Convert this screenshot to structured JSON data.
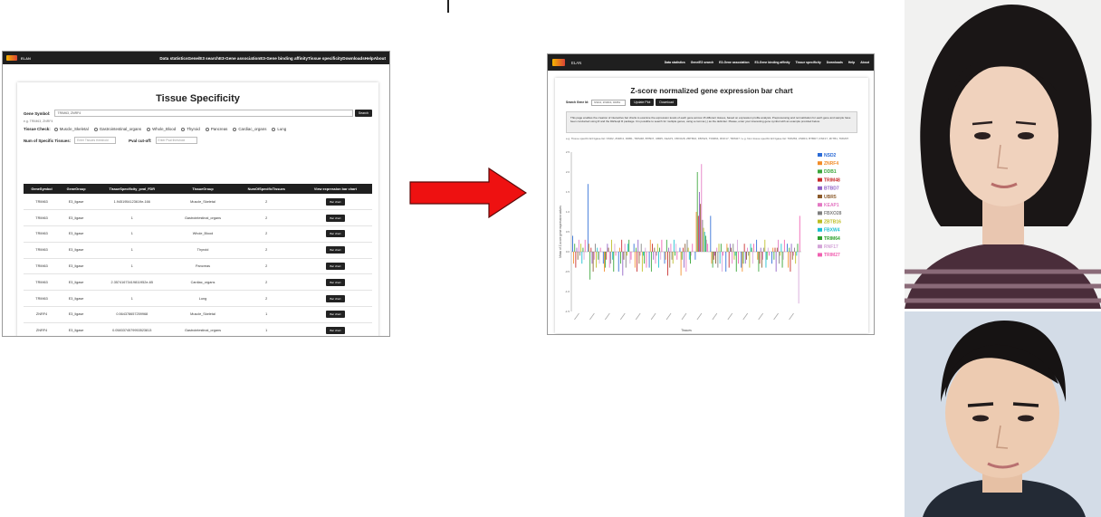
{
  "left_screenshot": {
    "nav": {
      "brand": "ELAN",
      "items": [
        "Data statistics",
        "Gene/E3 search",
        "E3-Gene association",
        "E3-Gene binding affinity",
        "Tissue specificity",
        "Downloads",
        "Help",
        "About"
      ]
    },
    "title": "Tissue Specificity",
    "gene_symbol_label": "Gene Symbol:",
    "gene_symbol_value": "TRIM63, ZNRF4",
    "search_button": "Search",
    "example_text": "e.g. TRIM63, ZNRF4",
    "tissue_check_label": "Tissue Check:",
    "tissue_options": [
      "Muscle_Skeletal",
      "Gastrointestinal_organs",
      "Whole_Blood",
      "Thyroid",
      "Pancreas",
      "Cardiac_organs",
      "Lung"
    ],
    "num_tissues_label": "Num of Specific Tissues:",
    "num_tissues_placeholder": "Enter Tissues threshold",
    "pval_label": "Pval cut-off:",
    "pval_placeholder": "Enter Pval threshold",
    "table": {
      "headers": [
        "GeneSymbol",
        "GeneGroup",
        "TissueSpecificity_pval_FDR",
        "TissueGroup",
        "NumOfSpecificTissues",
        "View expression bar chart"
      ],
      "rows": [
        [
          "TRIM63",
          "E3_ligase",
          "1.9451954123619e-166",
          "Muscle_Skeletal",
          "2",
          "Bar chart"
        ],
        [
          "TRIM63",
          "E3_ligase",
          "1",
          "Gastrointestinal_organs",
          "2",
          "Bar chart"
        ],
        [
          "TRIM63",
          "E3_ligase",
          "1",
          "Whole_Blood",
          "2",
          "Bar chart"
        ],
        [
          "TRIM63",
          "E3_ligase",
          "1",
          "Thyroid",
          "2",
          "Bar chart"
        ],
        [
          "TRIM63",
          "E3_ligase",
          "1",
          "Pancreas",
          "2",
          "Bar chart"
        ],
        [
          "TRIM63",
          "E3_ligase",
          "2.35741673419811952e-65",
          "Cardiac_organs",
          "2",
          "Bar chart"
        ],
        [
          "TRIM63",
          "E3_ligase",
          "1",
          "Lung",
          "2",
          "Bar chart"
        ],
        [
          "ZNRF4",
          "E3_ligase",
          "0.564378657259968",
          "Muscle_Skeletal",
          "1",
          "Bar chart"
        ],
        [
          "ZNRF4",
          "E3_ligase",
          "0.0583374579953523813",
          "Gastrointestinal_organs",
          "1",
          "Bar chart"
        ]
      ]
    }
  },
  "right_screenshot": {
    "nav": {
      "brand": "ELAN",
      "items": [
        "Data statistics",
        "Gene/E3 search",
        "E3-Gene association",
        "E3-Gene binding affinity",
        "Tissue specificity",
        "Downloads",
        "Help",
        "About"
      ]
    },
    "title": "Z-score normalized gene expression bar chart",
    "search_label": "Search Gene Id:",
    "search_value": "NSD2, ZNRF4, DDB1",
    "draw_button": "Update Plot",
    "download_button": "Download",
    "info_text": "This page enables the creation of interactive bar charts to examine the expression levels of each gene across 15 different tissues, based on expression profile analysis. Preprocessing and normalization for each gene and sample have been conducted using R and the DESeq2 R package. It is possible to search for multiple genes, using a comma (,) as the delimiter. Please, enter your interesting gene symbol with an example provided below.",
    "note_text": "e.g. Tissue specific E3 ligase list: NSD2, ZNRF4, DDB1, TRIM48, BTBD7, UBR5, KEAP1, FBXO28, ZBTB16, FBXW4, TRIM64, RNF17, TRIM27 / e.g. Non tissue specific E3 ligase list: TRIM63, ZNRF4, BTBD7, RNF17, ZFTB1, TRIM37",
    "y_axis_label": "Mean of Z-score gene expression values",
    "x_axis_label": "Tissues"
  },
  "chart_data": {
    "type": "bar",
    "title": "Z-score normalized gene expression bar chart",
    "xlabel": "Tissues",
    "ylabel": "Mean of Z-score gene expression values",
    "ylim": [
      -1.5,
      2.5
    ],
    "legend_position": "right",
    "categories": [
      "T1",
      "T2",
      "T3",
      "T4",
      "T5",
      "T6",
      "T7",
      "T8",
      "T9",
      "T10",
      "T11",
      "T12",
      "T13",
      "T14",
      "T15"
    ],
    "series": [
      {
        "name": "NSD2",
        "color": "#2b6bd6",
        "values": [
          0.4,
          1.7,
          -0.3,
          -0.5,
          0.2,
          -0.4,
          -0.3,
          0.1,
          -0.2,
          0.9,
          -0.5,
          -0.4,
          0.3,
          -0.3,
          0.2
        ]
      },
      {
        "name": "ZNRF4",
        "color": "#f28c28",
        "values": [
          -0.3,
          0.2,
          -0.5,
          0.1,
          -0.4,
          0.3,
          -0.2,
          -0.6,
          1.0,
          -0.3,
          0.2,
          -0.5,
          -0.2,
          0.1,
          -0.4
        ]
      },
      {
        "name": "DDB1",
        "color": "#3aa63a",
        "values": [
          0.2,
          -0.7,
          -0.4,
          -0.3,
          0.1,
          -0.5,
          0.3,
          -0.2,
          2.0,
          -0.4,
          0.1,
          -0.3,
          -0.5,
          -0.2,
          0.1
        ]
      },
      {
        "name": "TRIM48",
        "color": "#c62828",
        "values": [
          -0.4,
          0.1,
          -0.2,
          0.3,
          -0.5,
          0.2,
          -0.6,
          0.1,
          0.9,
          -0.2,
          -0.4,
          0.2,
          -0.3,
          0.1,
          -0.5
        ]
      },
      {
        "name": "BTBD7",
        "color": "#8e5ec4",
        "values": [
          0.1,
          -0.3,
          0.2,
          -0.6,
          0.3,
          -0.2,
          0.1,
          -0.4,
          1.5,
          -0.1,
          0.2,
          -0.3,
          0.1,
          -0.5,
          0.2
        ]
      },
      {
        "name": "UBR5",
        "color": "#8b5a2b",
        "values": [
          -0.2,
          -0.5,
          0.1,
          -0.2,
          -0.3,
          0.1,
          -0.4,
          0.2,
          1.2,
          -0.3,
          0.1,
          -0.2,
          -0.4,
          0.1,
          -0.2
        ]
      },
      {
        "name": "KEAP1",
        "color": "#e377c2",
        "values": [
          0.3,
          -0.2,
          -0.4,
          0.2,
          -0.1,
          -0.3,
          0.2,
          -0.5,
          2.2,
          0.1,
          -0.3,
          0.1,
          -0.2,
          0.3,
          -0.1
        ]
      },
      {
        "name": "FBXO28",
        "color": "#7f7f7f",
        "values": [
          -0.1,
          0.2,
          -0.3,
          -0.4,
          0.2,
          -0.1,
          -0.2,
          0.3,
          0.8,
          -0.4,
          0.2,
          -0.1,
          0.1,
          -0.3,
          0.1
        ]
      },
      {
        "name": "ZBTB16",
        "color": "#bcbd22",
        "values": [
          0.2,
          -0.4,
          0.3,
          -0.1,
          -0.5,
          0.2,
          -0.3,
          0.1,
          0.6,
          0.2,
          -0.2,
          -0.4,
          0.3,
          -0.1,
          -0.3
        ]
      },
      {
        "name": "FBXW4",
        "color": "#17becf",
        "values": [
          -0.3,
          0.1,
          -0.2,
          0.2,
          -0.1,
          -0.4,
          0.3,
          -0.2,
          0.5,
          -0.3,
          -0.1,
          0.2,
          -0.4,
          0.2,
          -0.1
        ]
      },
      {
        "name": "TRIM64",
        "color": "#2ca02c",
        "values": [
          0.1,
          -0.2,
          -0.5,
          0.3,
          -0.3,
          0.1,
          -0.1,
          -0.3,
          0.4,
          0.2,
          -0.5,
          0.1,
          -0.2,
          -0.4,
          0.2
        ]
      },
      {
        "name": "RNF17",
        "color": "#d4a4d8",
        "values": [
          -0.2,
          -0.3,
          0.2,
          -0.3,
          0.1,
          -0.2,
          0.2,
          -0.1,
          0.3,
          -0.5,
          0.3,
          -0.3,
          0.1,
          -0.2,
          -1.3
        ]
      },
      {
        "name": "TRIM27",
        "color": "#f05fb0",
        "values": [
          0.3,
          0.1,
          -0.1,
          -0.2,
          -0.4,
          0.3,
          -0.2,
          0.2,
          0.2,
          -0.1,
          -0.3,
          0.2,
          -0.1,
          0.3,
          0.9
        ]
      }
    ]
  }
}
